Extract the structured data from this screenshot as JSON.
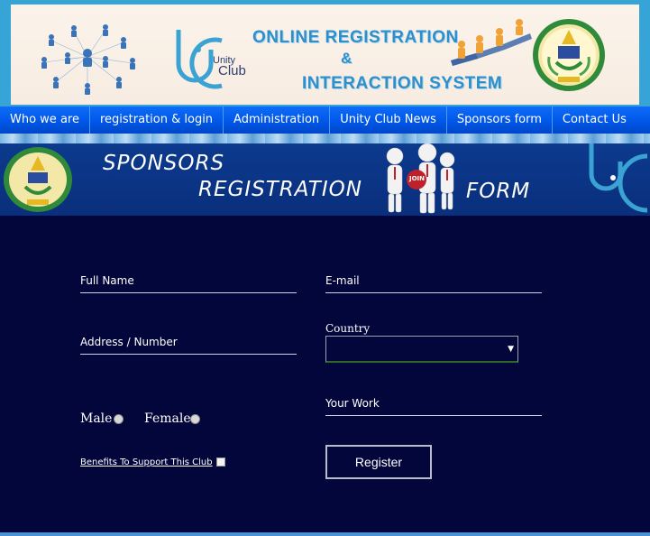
{
  "header": {
    "title_line1": "ONLINE REGISTRATION",
    "title_line2": "&",
    "title_line3": "INTERACTION SYSTEM",
    "logo_small": "Unity",
    "logo_big": "Club",
    "accent_color": "#2f8fcb"
  },
  "nav": {
    "items": [
      {
        "label": "Who we are"
      },
      {
        "label": "registration & login"
      },
      {
        "label": "Administration"
      },
      {
        "label": "Unity Club News"
      },
      {
        "label": "Sponsors form"
      },
      {
        "label": "Contact Us"
      }
    ]
  },
  "banner": {
    "word1": "SPONSORS",
    "word2": "REGISTRATION",
    "word3": "FORM",
    "join_badge": "JOIN"
  },
  "form": {
    "full_name_label": "Full Name",
    "email_label": "E-mail",
    "address_label": "Address / Number",
    "country_label": "Country",
    "country_selected": "",
    "work_label": "Your Work",
    "male_label": "Male",
    "female_label": "Female",
    "benefits_link": "Benefits To Support This Club",
    "register_button": "Register"
  }
}
